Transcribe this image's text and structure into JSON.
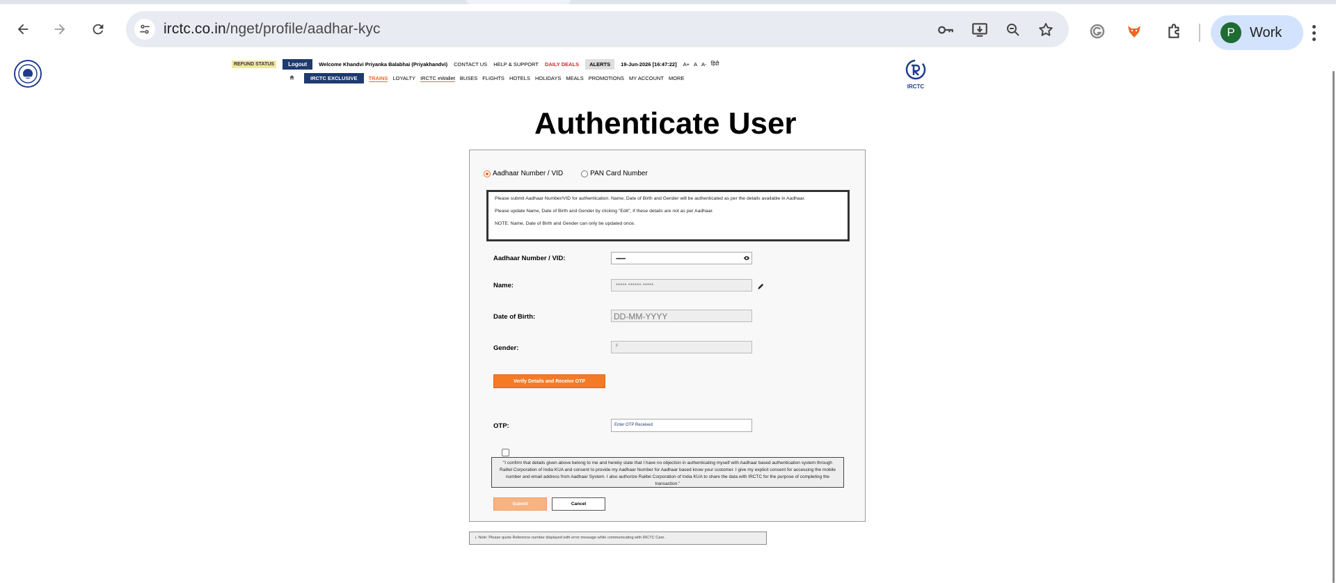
{
  "browser": {
    "url_host": "irctc.co.in",
    "url_path": "/nget/profile/aadhar-kyc",
    "profile_initial": "P",
    "profile_name": "Work"
  },
  "header": {
    "refund_status": "REFUND STATUS",
    "logout": "Logout",
    "welcome": "Welcome Khandvi Priyanka Balabhai (Priyakhandvi)",
    "contact": "CONTACT US",
    "help": "HELP & SUPPORT",
    "daily_deals": "DAILY DEALS",
    "alerts": "ALERTS",
    "datetime": "19-Jun-2026 [16:47:22]",
    "font_plus": "A+",
    "font_normal": "A",
    "font_minus": "A-",
    "hindi": "हिंदी",
    "logo_text": "IRCTC"
  },
  "nav": {
    "home_icon": "home-icon",
    "exclusive": "IRCTC EXCLUSIVE",
    "items": [
      "TRAINS",
      "LOYALTY",
      "IRCTC eWallet",
      "BUSES",
      "FLIGHTS",
      "HOTELS",
      "HOLIDAYS",
      "MEALS",
      "PROMOTIONS",
      "MY ACCOUNT",
      "MORE"
    ]
  },
  "main": {
    "title": "Authenticate User",
    "radio_aadhaar": "Aadhaar Number / VID",
    "radio_pan": "PAN Card Number",
    "notice_1": "Please submit Aadhaar Number/VID for authentication. Name, Date of Birth and Gender will be authenticated as per the details available in Aadhaar.",
    "notice_2": "Please update Name, Date of Birth and Gender by clicking \"Edit\", if these details are not as per Aadhaar.",
    "notice_3": "NOTE: Name, Date of Birth and Gender can only be updated once.",
    "aadhaar_label": "Aadhaar Number / VID:",
    "aadhaar_value": "••••••••••••",
    "name_label": "Name:",
    "name_value": "***** ****** *****",
    "dob_label": "Date of Birth:",
    "dob_placeholder": "DD-MM-YYYY",
    "gender_label": "Gender:",
    "gender_value": "F",
    "verify_button": "Verify Details and Receive OTP",
    "otp_label": "OTP:",
    "otp_placeholder": "Enter OTP Received",
    "consent": "\"I confirm that details given above belong to me and hereby state that I have no objection in authenticating myself with Aadhaar based authentication system through Railtel Corporation of India KUA and consent to provide my Aadhaar Number for Aadhaar based know your customer. I give my explicit consent for accessing the mobile number and email address from Aadhaar System. I also authorize Railtel Corporation of India KUA to share the data with IRCTC for the purpose of completing the transaction.\"",
    "submit_button": "Submit",
    "cancel_button": "Cancel",
    "footnote": "i. Note: Please quote Reference number displayed with error message while communicating with IRCTC Care."
  },
  "colors": {
    "accent_orange": "#f47a26",
    "navy": "#1e3a6e",
    "deal_red": "#d7262e"
  }
}
